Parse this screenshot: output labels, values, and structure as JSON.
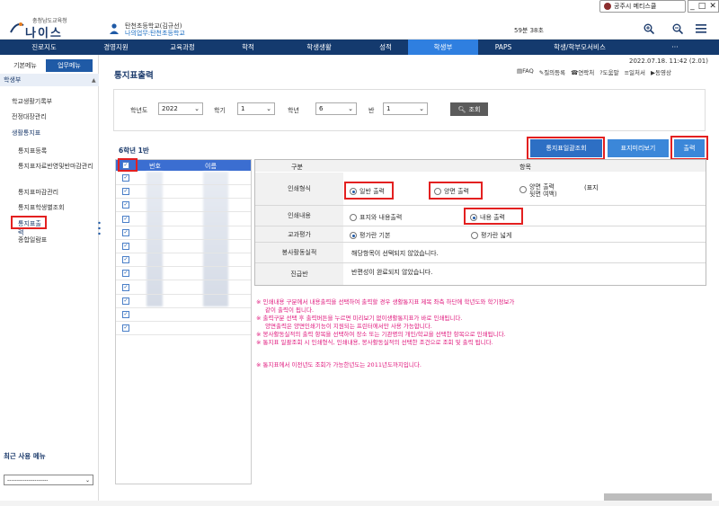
{
  "header": {
    "ext_button": "공주시 메티스쿨",
    "logo_small": "충청남도교육청",
    "logo_text": "나이스",
    "user_name": "탄천초등학교(김규선)",
    "user_org": "나의업무:탄천초등학교",
    "timer": "59분 38초"
  },
  "nav": {
    "items": [
      "진로지도",
      "경영지원",
      "교육과정",
      "학적",
      "학생생활",
      "성적",
      "학생부",
      "PAPS",
      "학생/학부모서비스",
      "···"
    ],
    "active_index": 6
  },
  "sidebar": {
    "tab_basic": "기본메뉴",
    "tab_work": "업무메뉴",
    "section": "학생부",
    "items": [
      "학교생활기록부",
      "전정대장관리",
      "생활통지표"
    ],
    "subitems": [
      "통지표등록",
      "통지표자료반영및반마감관리",
      "통지표마감관리",
      "통지표학생별조회",
      "통지표출력",
      "종합일람표"
    ],
    "selected_sub": "통지표출력",
    "recent_title": "최근 사용 메뉴",
    "recent_select": "---------------------"
  },
  "main": {
    "title": "통지표출력",
    "datetime": "2022.07.18. 11:42 (2.01)",
    "toolbar": [
      "FAQ",
      "질의등록",
      "연락처",
      "도움말",
      "일처서",
      "동영상"
    ]
  },
  "filters": {
    "year_label": "학년도",
    "year_value": "2022",
    "term_label": "학기",
    "term_value": "1",
    "grade_label": "학년",
    "grade_value": "6",
    "class_label": "반",
    "class_value": "1",
    "search_label": "조회"
  },
  "grade_title": "6학년 1반",
  "buttons": {
    "batch_view": "통지표일괄조회",
    "cover_preview": "표지미리보기",
    "print": "출력"
  },
  "student_table": {
    "col_no": "번호",
    "col_name": "이름",
    "row_count": 12
  },
  "options": {
    "header_col1": "구분",
    "header_col2": "항목",
    "rows": [
      {
        "label": "인쇄형식",
        "opts": [
          "일반 출력",
          "양면 출력",
          "양면 출력\n뒷면 여백)"
        ],
        "extra": "(표지"
      },
      {
        "label": "인쇄내용",
        "opts": [
          "표지와 내용출력",
          "내용 출력"
        ]
      },
      {
        "label": "교과평가",
        "opts": [
          "평가란 기본",
          "평가란 넓게"
        ]
      },
      {
        "label": "봉사활동실적",
        "text": "해당항목이 선택되지 않았습니다."
      },
      {
        "label": "진급반",
        "text": "반편성이 완료되지 않았습니다."
      }
    ]
  },
  "notes": [
    "※ 인쇄내용 구분에서 내용출력을 선택하여 출력할 경우 생활통지표 제목 좌측 하단에 학년도와 학기정보가",
    "같이 출력이 됩니다.",
    "※ 출력구분 선택 후 출력버튼을 누르면 미리보기 없이생활통지표가 바로 인쇄됩니다.",
    "양면출력은 양면인쇄기능이 지원되는 프린터에서만 사용 가능합니다.",
    "※ 봉사활동실적의 출력 항목을 선택하여 장소 또는 기관명의 개인/학교을 선택한 항목으로 인쇄됩니다.",
    "※ 통지표 일괄조회 시 인쇄형식, 인쇄내용, 봉사활동실적의 선택한 조건으로 조회 및 출력 됩니다.",
    "※ 통지표에서 이전년도 조회가 가능한년도는 2011년도까지입니다."
  ]
}
